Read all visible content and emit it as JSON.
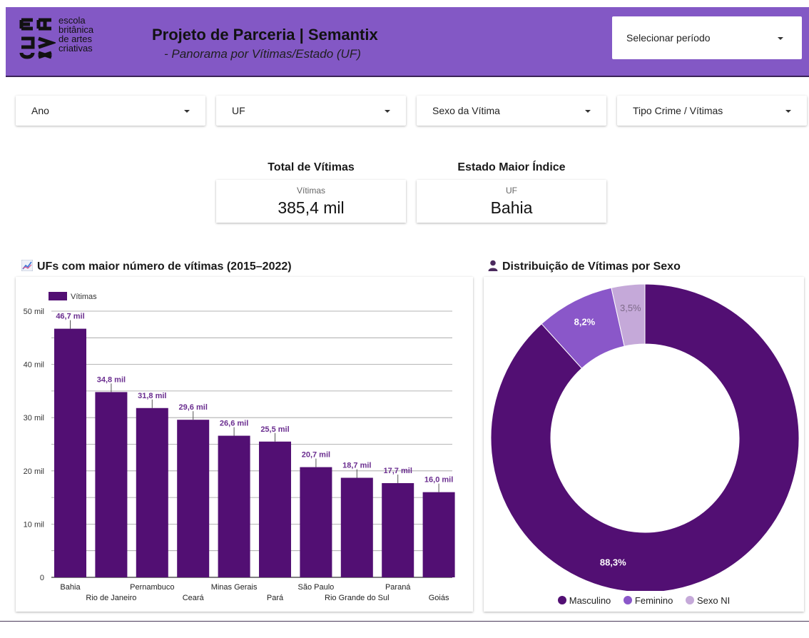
{
  "header": {
    "logo_lines": [
      "escola",
      "britânica",
      "de artes",
      "criativas"
    ],
    "title": "Projeto de Parceria | Semantix",
    "subtitle": "- Panorama por Vítimas/Estado (UF)",
    "period_select": "Selecionar período"
  },
  "colors": {
    "header_bg": "#8358c5",
    "primary": "#520f73",
    "secondary": "#8a57c9",
    "tertiary": "#c5a9d9",
    "data_label": "#6a2d8f"
  },
  "filters": [
    "Ano",
    "UF",
    "Sexo da Vítima",
    "Tipo Crime / Vítimas"
  ],
  "kpis": {
    "total": {
      "title": "Total de Vítimas",
      "label": "Vítimas",
      "value": "385,4 mil"
    },
    "top_state": {
      "title": "Estado Maior Índice",
      "label": "UF",
      "value": "Bahia"
    }
  },
  "sections": {
    "bar_title": "UFs com maior número de vítimas (2015–2022)",
    "bar_icon": "chart-line-icon",
    "donut_title": "Distribuição de Vítimas por Sexo",
    "donut_icon": "person-icon"
  },
  "chart_data": [
    {
      "type": "bar",
      "legend": [
        "Vítimas"
      ],
      "categories": [
        "Bahia",
        "Rio de Janeiro",
        "Pernambuco",
        "Ceará",
        "Minas Gerais",
        "Pará",
        "São Paulo",
        "Rio Grande do Sul",
        "Paraná",
        "Goiás"
      ],
      "series": [
        {
          "name": "Vítimas",
          "values": [
            46.7,
            34.8,
            31.8,
            29.6,
            26.6,
            25.5,
            20.7,
            18.7,
            17.7,
            16.0
          ]
        }
      ],
      "data_labels": [
        "46,7 mil",
        "34,8 mil",
        "31,8 mil",
        "29,6 mil",
        "26,6 mil",
        "25,5 mil",
        "20,7 mil",
        "18,7 mil",
        "17,7 mil",
        "16,0 mil"
      ],
      "y_ticks": [
        0,
        10,
        20,
        30,
        40,
        50
      ],
      "y_tick_labels": [
        "0",
        "10 mil",
        "20 mil",
        "30 mil",
        "40 mil",
        "50 mil"
      ],
      "ylim": [
        0,
        50
      ],
      "grid": true,
      "legend_position": "top-left"
    },
    {
      "type": "pie",
      "donut": true,
      "categories": [
        "Masculino",
        "Feminino",
        "Sexo NI"
      ],
      "values": [
        88.3,
        8.2,
        3.5
      ],
      "labels": [
        "88,3%",
        "8,2%",
        "3,5%"
      ],
      "legend_position": "bottom"
    }
  ]
}
